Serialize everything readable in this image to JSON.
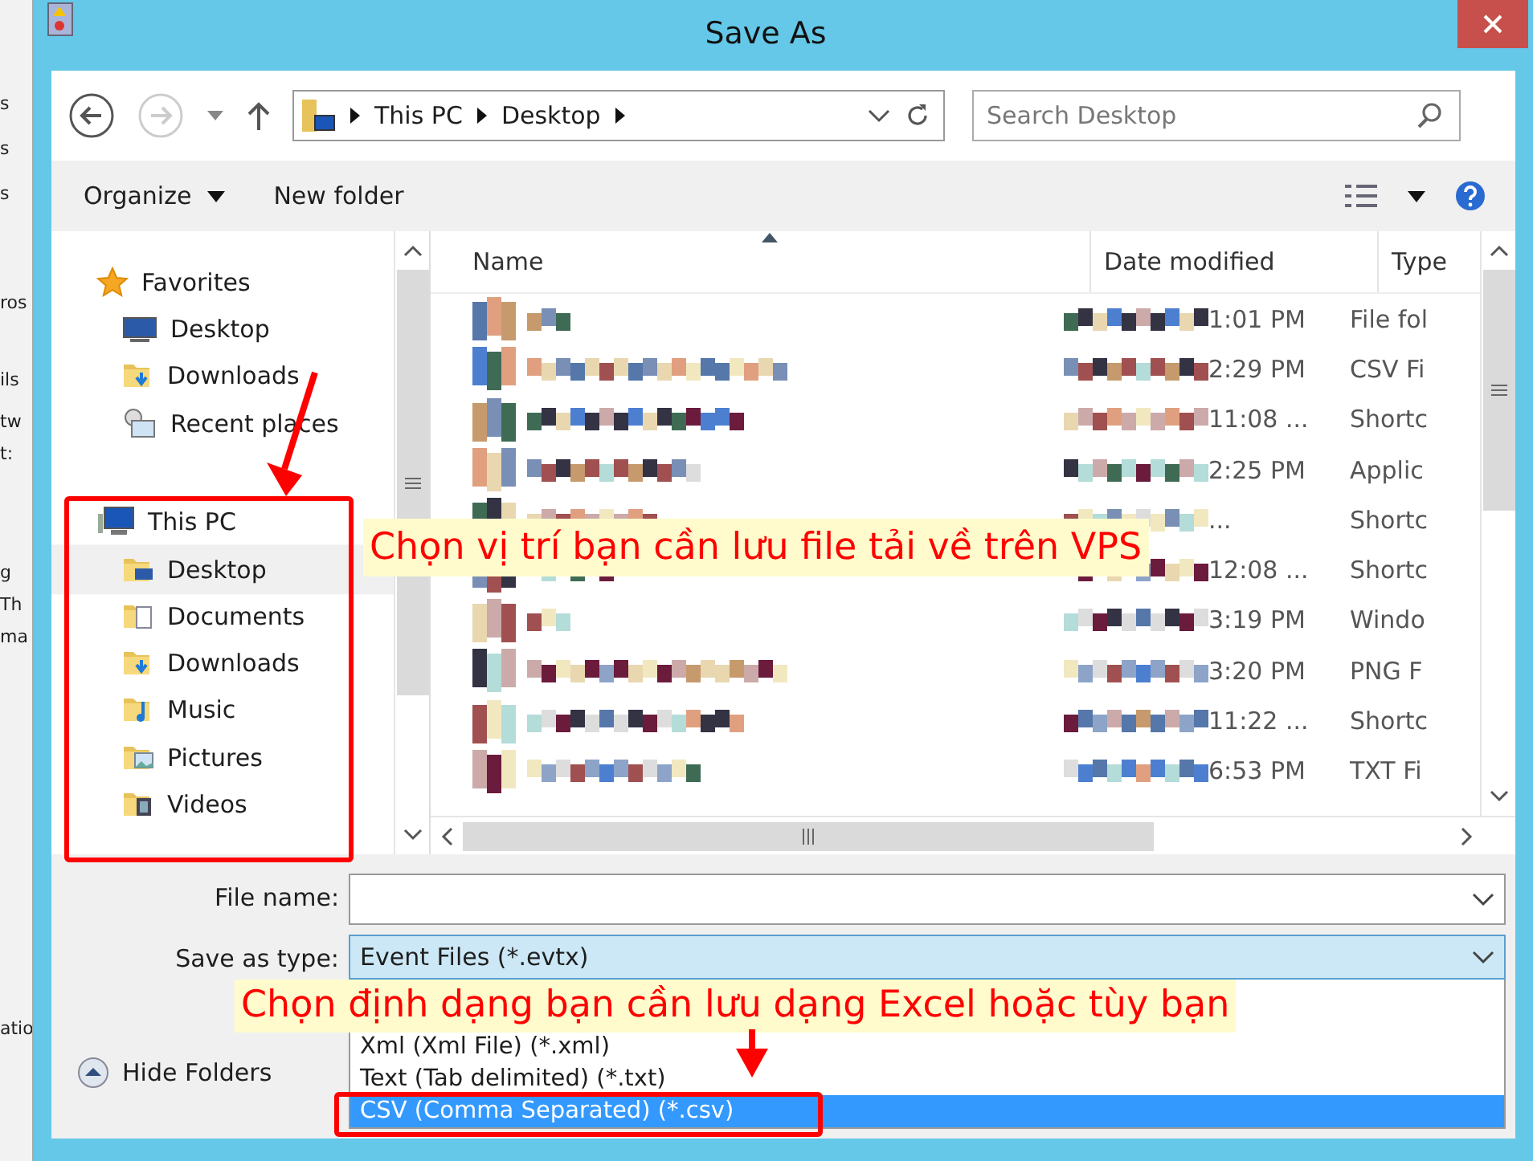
{
  "background_window": {
    "fragments": [
      "s",
      "s",
      "s",
      "ros",
      "ils",
      "tw",
      "t:",
      "g",
      "Th",
      "ma",
      "atio"
    ]
  },
  "window": {
    "title": "Save As"
  },
  "address": {
    "crumbs": [
      "This PC",
      "Desktop"
    ],
    "search_placeholder": "Search Desktop"
  },
  "toolbar": {
    "organize": "Organize",
    "new_folder": "New folder"
  },
  "sidebar": {
    "items": [
      {
        "label": "Favorites",
        "kind": "star",
        "selected": false,
        "children": [
          {
            "label": "Desktop",
            "kind": "screen",
            "selected": false
          },
          {
            "label": "Downloads",
            "kind": "download",
            "selected": false
          },
          {
            "label": "Recent places",
            "kind": "recent",
            "selected": false
          }
        ]
      },
      {
        "label": "This PC",
        "kind": "pc",
        "selected": false,
        "children": [
          {
            "label": "Desktop",
            "kind": "folder-screen",
            "selected": true
          },
          {
            "label": "Documents",
            "kind": "documents",
            "selected": false
          },
          {
            "label": "Downloads",
            "kind": "download",
            "selected": false
          },
          {
            "label": "Music",
            "kind": "music",
            "selected": false
          },
          {
            "label": "Pictures",
            "kind": "pictures",
            "selected": false
          },
          {
            "label": "Videos",
            "kind": "videos",
            "selected": false
          }
        ]
      }
    ]
  },
  "table": {
    "columns": [
      "Name",
      "Date modified",
      "Type"
    ],
    "rows": [
      {
        "time": "1:01 PM",
        "type": "File fol"
      },
      {
        "time": "2:29 PM",
        "type": "CSV Fi"
      },
      {
        "time": "11:08 ...",
        "type": "Shortc"
      },
      {
        "time": "2:25 PM",
        "type": "Applic"
      },
      {
        "time": "...",
        "type": "Shortc"
      },
      {
        "time": "12:08 ...",
        "type": "Shortc"
      },
      {
        "time": "3:19 PM",
        "type": "Windo"
      },
      {
        "time": "3:20 PM",
        "type": "PNG F"
      },
      {
        "time": "11:22 ...",
        "type": "Shortc"
      },
      {
        "time": "6:53 PM",
        "type": "TXT Fi"
      }
    ]
  },
  "form": {
    "file_name_label": "File name:",
    "type_label": "Save as type:",
    "type_value": "Event Files (*.evtx)",
    "options": [
      {
        "label": "Xml (Xml File) (*.xml)",
        "selected": false
      },
      {
        "label": "Text (Tab delimited) (*.txt)",
        "selected": false
      },
      {
        "label": "CSV (Comma Separated) (*.csv)",
        "selected": true
      }
    ]
  },
  "hide_folders": "Hide Folders",
  "annotations": [
    {
      "text": "Chọn vị trí bạn cần lưu file tải về trên VPS"
    },
    {
      "text": "Chọn định dạng bạn cần lưu dạng Excel hoặc tùy bạn"
    }
  ]
}
